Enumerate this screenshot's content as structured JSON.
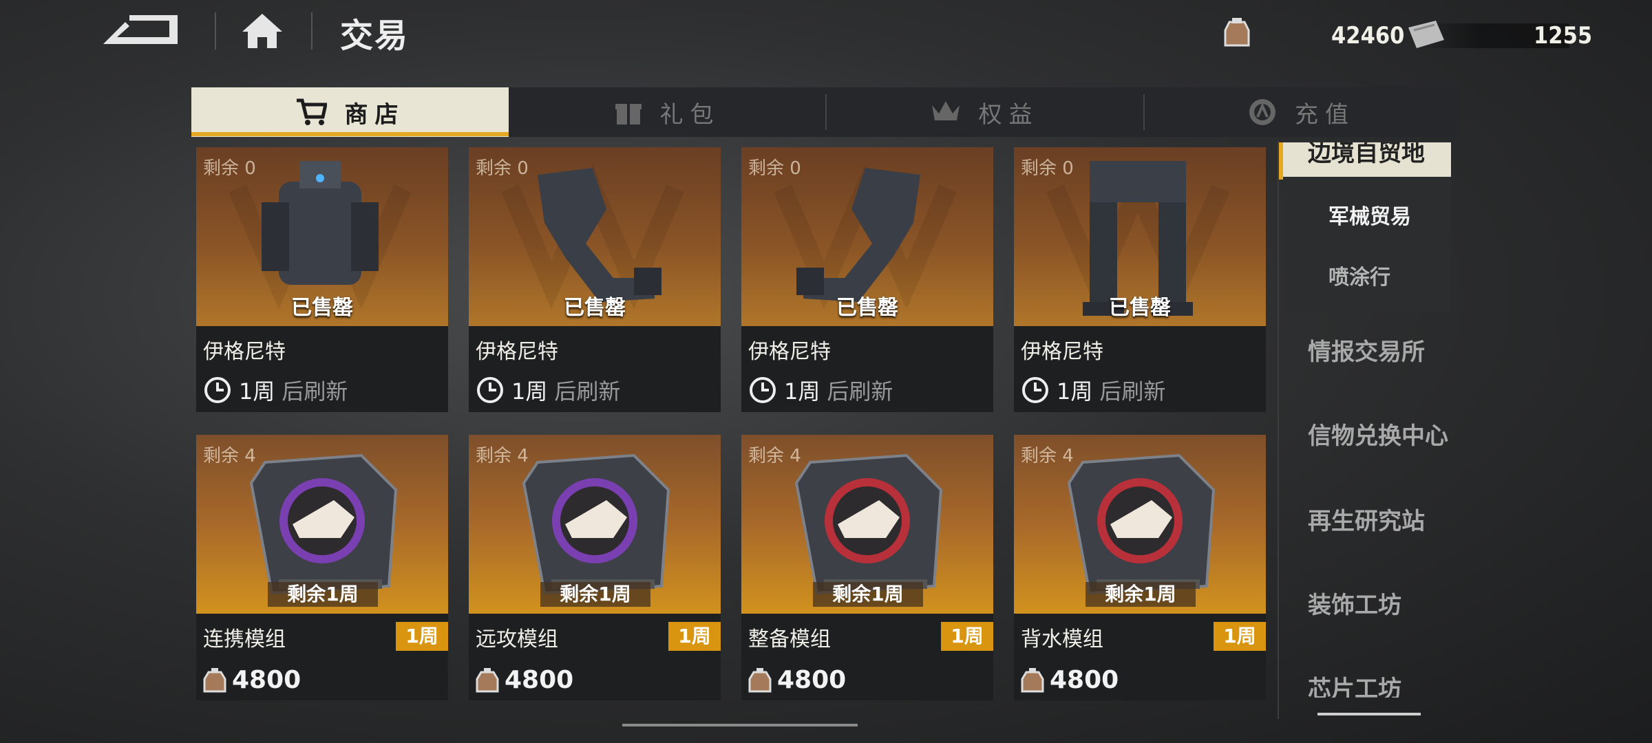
{
  "header": {
    "title": "交易",
    "currency_1": {
      "icon": "bag-coin-icon",
      "value": "42460"
    },
    "currency_2": {
      "icon": "ticket-icon",
      "value": "1255"
    }
  },
  "tabs": [
    {
      "label": "商店",
      "icon": "cart-icon",
      "active": true
    },
    {
      "label": "礼包",
      "icon": "gift-icon",
      "active": false
    },
    {
      "label": "权益",
      "icon": "crown-icon",
      "active": false
    },
    {
      "label": "充值",
      "icon": "coin-icon",
      "active": false
    }
  ],
  "shop_cards_row1": [
    {
      "remain": "剩余 0",
      "status": "已售罄",
      "name": "伊格尼特",
      "refresh_week": "1周",
      "refresh_after": "后刷新"
    },
    {
      "remain": "剩余 0",
      "status": "已售罄",
      "name": "伊格尼特",
      "refresh_week": "1周",
      "refresh_after": "后刷新"
    },
    {
      "remain": "剩余 0",
      "status": "已售罄",
      "name": "伊格尼特",
      "refresh_week": "1周",
      "refresh_after": "后刷新"
    },
    {
      "remain": "剩余 0",
      "status": "已售罄",
      "name": "伊格尼特",
      "refresh_week": "1周",
      "refresh_after": "后刷新"
    }
  ],
  "shop_cards_row2": [
    {
      "remain": "剩余 4",
      "remain_week": "剩余1周",
      "name": "连携模组",
      "badge": "1周",
      "price": "4800",
      "ring": "#7a3fb0"
    },
    {
      "remain": "剩余 4",
      "remain_week": "剩余1周",
      "name": "远攻模组",
      "badge": "1周",
      "price": "4800",
      "ring": "#7a3fb0"
    },
    {
      "remain": "剩余 4",
      "remain_week": "剩余1周",
      "name": "整备模组",
      "badge": "1周",
      "price": "4800",
      "ring": "#b8303a"
    },
    {
      "remain": "剩余 4",
      "remain_week": "剩余1周",
      "name": "背水模组",
      "badge": "1周",
      "price": "4800",
      "ring": "#b8303a"
    }
  ],
  "side_nav": {
    "active_partial": "边境自贸地",
    "sub_items": [
      "军械贸易",
      "喷涂行"
    ],
    "items": [
      "情报交易所",
      "信物兑换中心",
      "再生研究站",
      "装饰工坊",
      "芯片工坊"
    ]
  },
  "colors": {
    "accent": "#e4a823",
    "badge": "#d9950f",
    "card_bg": "#1e1f20"
  }
}
